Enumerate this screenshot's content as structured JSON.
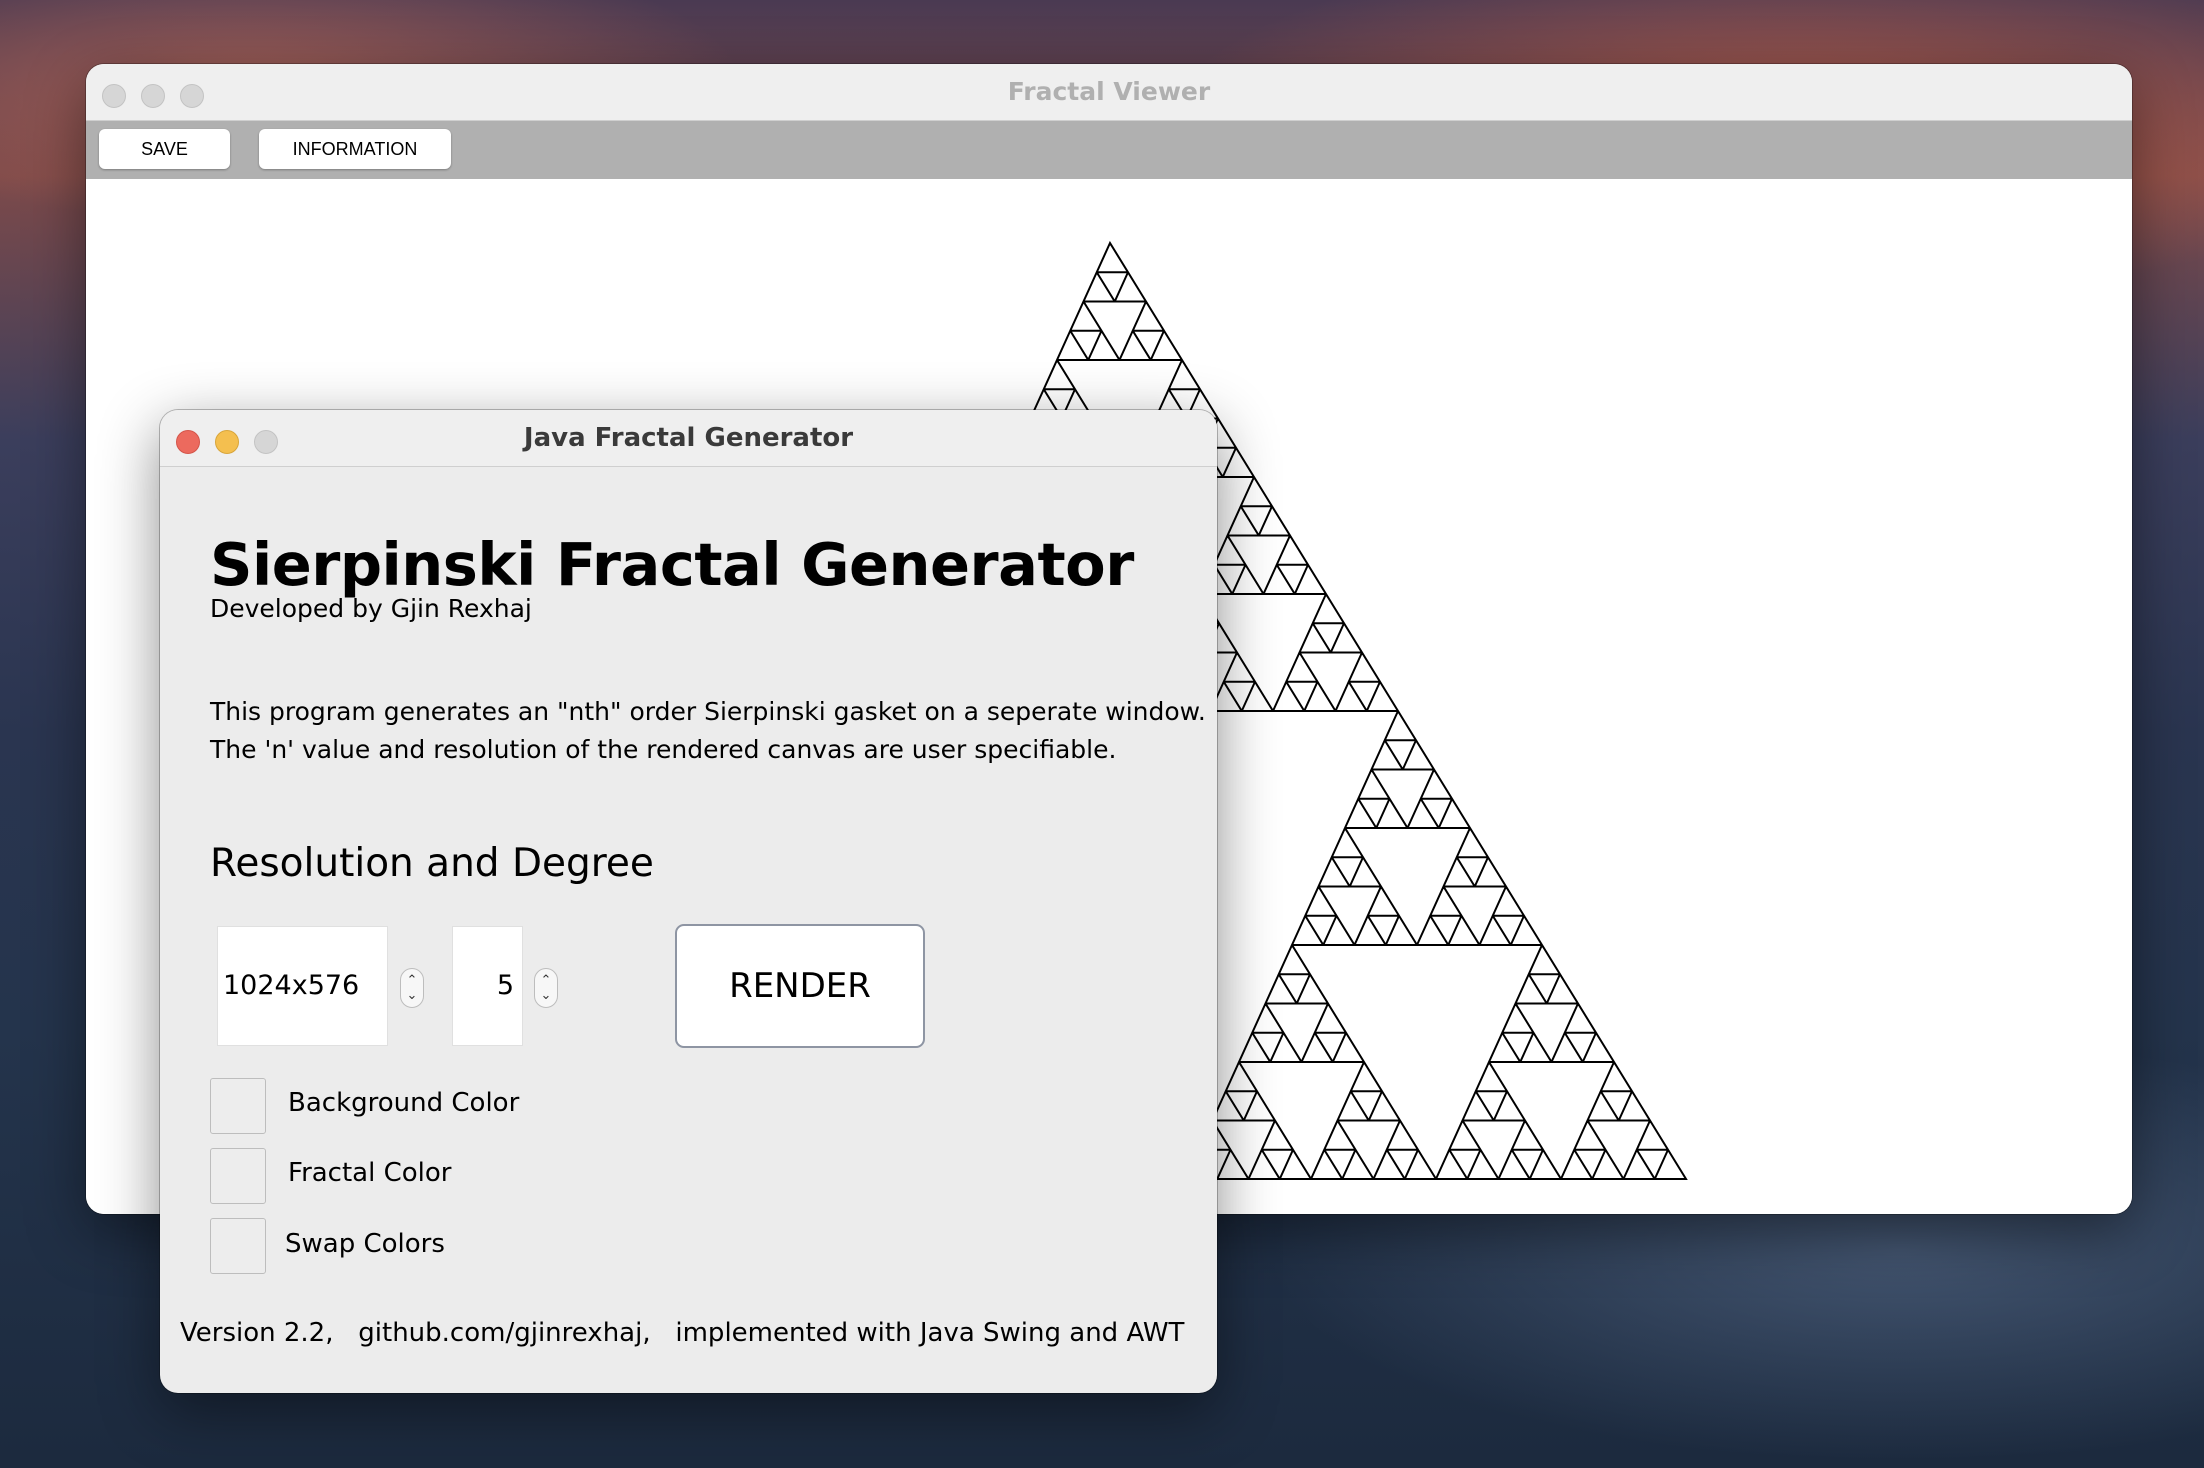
{
  "viewer": {
    "title": "Fractal Viewer",
    "toolbar": {
      "save_label": "SAVE",
      "information_label": "INFORMATION"
    },
    "fractal": {
      "type": "sierpinski-triangle",
      "order": 5,
      "stroke_color": "#000000",
      "background_color": "#ffffff"
    }
  },
  "generator": {
    "title": "Java Fractal Generator",
    "heading": "Sierpinski Fractal Generator",
    "subheading": "Developed by Gjin Rexhaj",
    "description_line1": "This program generates an \"nth\" order Sierpinski gasket on a seperate window.",
    "description_line2": "The 'n' value and resolution of the rendered canvas are user specifiable.",
    "section_title": "Resolution and Degree",
    "resolution_value": "1024x576",
    "degree_value": "5",
    "render_label": "RENDER",
    "background_color_label": "Background Color",
    "fractal_color_label": "Fractal Color",
    "swap_colors_label": "Swap Colors",
    "footer": "Version 2.2,   github.com/gjinrexhaj,   implemented with Java Swing and AWT"
  },
  "colors": {
    "close": "#ec6a5e",
    "minimize": "#f4bf4f",
    "inactive_button": "#d6d6d6",
    "toolbar": "#b0b0b0",
    "render_border": "#8e95a3"
  }
}
